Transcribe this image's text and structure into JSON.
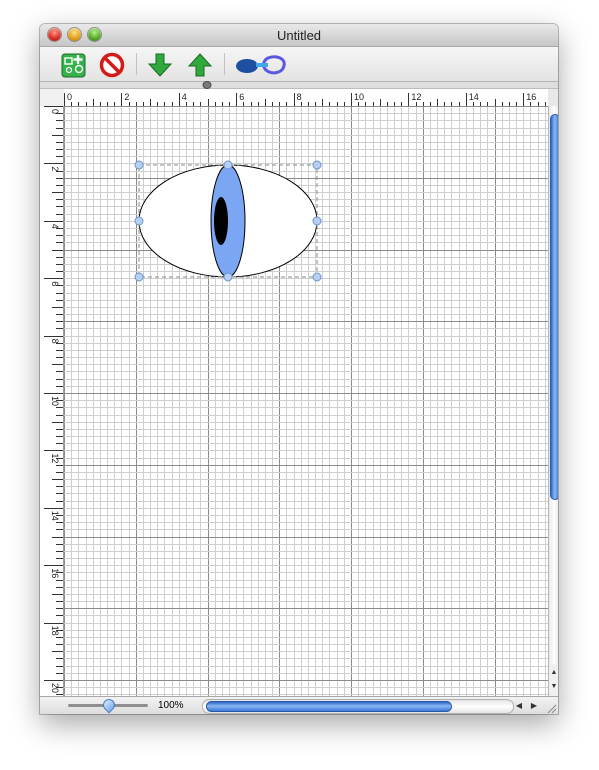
{
  "window": {
    "title": "Untitled"
  },
  "toolbar": {
    "buttons": [
      {
        "icon": "new-shape-icon"
      },
      {
        "icon": "delete-icon"
      },
      {
        "icon": "move-down-icon"
      },
      {
        "icon": "move-up-icon"
      },
      {
        "icon": "combine-shapes-icon"
      }
    ]
  },
  "rulers": {
    "horizontal_labels": [
      "0",
      "2",
      "4",
      "6",
      "8",
      "10",
      "12",
      "14",
      "16"
    ],
    "vertical_labels": [
      "0",
      "2",
      "4",
      "6",
      "8",
      "10",
      "12",
      "14",
      "16",
      "18",
      "20"
    ]
  },
  "canvas": {
    "shapes": [
      {
        "name": "outer-ellipse",
        "fill": "#ffffff",
        "stroke": "#000000"
      },
      {
        "name": "iris-ellipse",
        "fill": "#7aa6f4",
        "stroke": "#000000"
      },
      {
        "name": "pupil-ellipse",
        "fill": "#000000",
        "stroke": "#000000"
      }
    ],
    "selection_color": "#9ab8e8"
  },
  "status": {
    "zoom_label": "100%",
    "zoom_level": 1.0
  },
  "colors": {
    "accent": "#3b78d8"
  }
}
